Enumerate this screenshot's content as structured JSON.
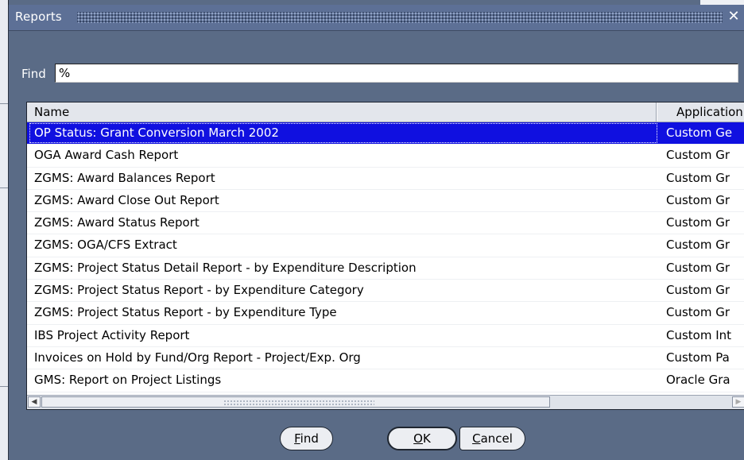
{
  "dialog": {
    "title": "Reports",
    "close_glyph": "✕"
  },
  "find": {
    "label": "Find",
    "value": "%"
  },
  "list": {
    "columns": {
      "name": "Name",
      "application": "Application"
    },
    "rows": [
      {
        "name": "OP Status: Grant Conversion March 2002",
        "application": "Custom Ge",
        "selected": true
      },
      {
        "name": "OGA Award Cash Report",
        "application": "Custom Gr"
      },
      {
        "name": "ZGMS: Award Balances Report",
        "application": "Custom Gr"
      },
      {
        "name": "ZGMS: Award Close Out Report",
        "application": "Custom Gr"
      },
      {
        "name": "ZGMS: Award Status Report",
        "application": "Custom Gr"
      },
      {
        "name": "ZGMS: OGA/CFS Extract",
        "application": "Custom Gr"
      },
      {
        "name": "ZGMS: Project Status Detail Report - by Expenditure Description",
        "application": "Custom Gr"
      },
      {
        "name": "ZGMS: Project Status Report - by Expenditure Category",
        "application": "Custom Gr"
      },
      {
        "name": "ZGMS: Project Status Report - by Expenditure Type",
        "application": "Custom Gr"
      },
      {
        "name": "IBS Project Activity Report",
        "application": "Custom Int"
      },
      {
        "name": "Invoices on Hold by Fund/Org Report - Project/Exp. Org",
        "application": "Custom Pa"
      },
      {
        "name": "GMS: Report on Project Listings",
        "application": "Oracle Gra"
      }
    ]
  },
  "buttons": {
    "find": {
      "mnemonic": "F",
      "rest": "ind"
    },
    "ok": {
      "mnemonic": "O",
      "rest": "K"
    },
    "cancel": {
      "mnemonic": "C",
      "rest": "ancel"
    }
  },
  "icons": {
    "scroll_left": "arrow-left-icon",
    "scroll_right": "arrow-right-icon",
    "close": "close-icon"
  }
}
